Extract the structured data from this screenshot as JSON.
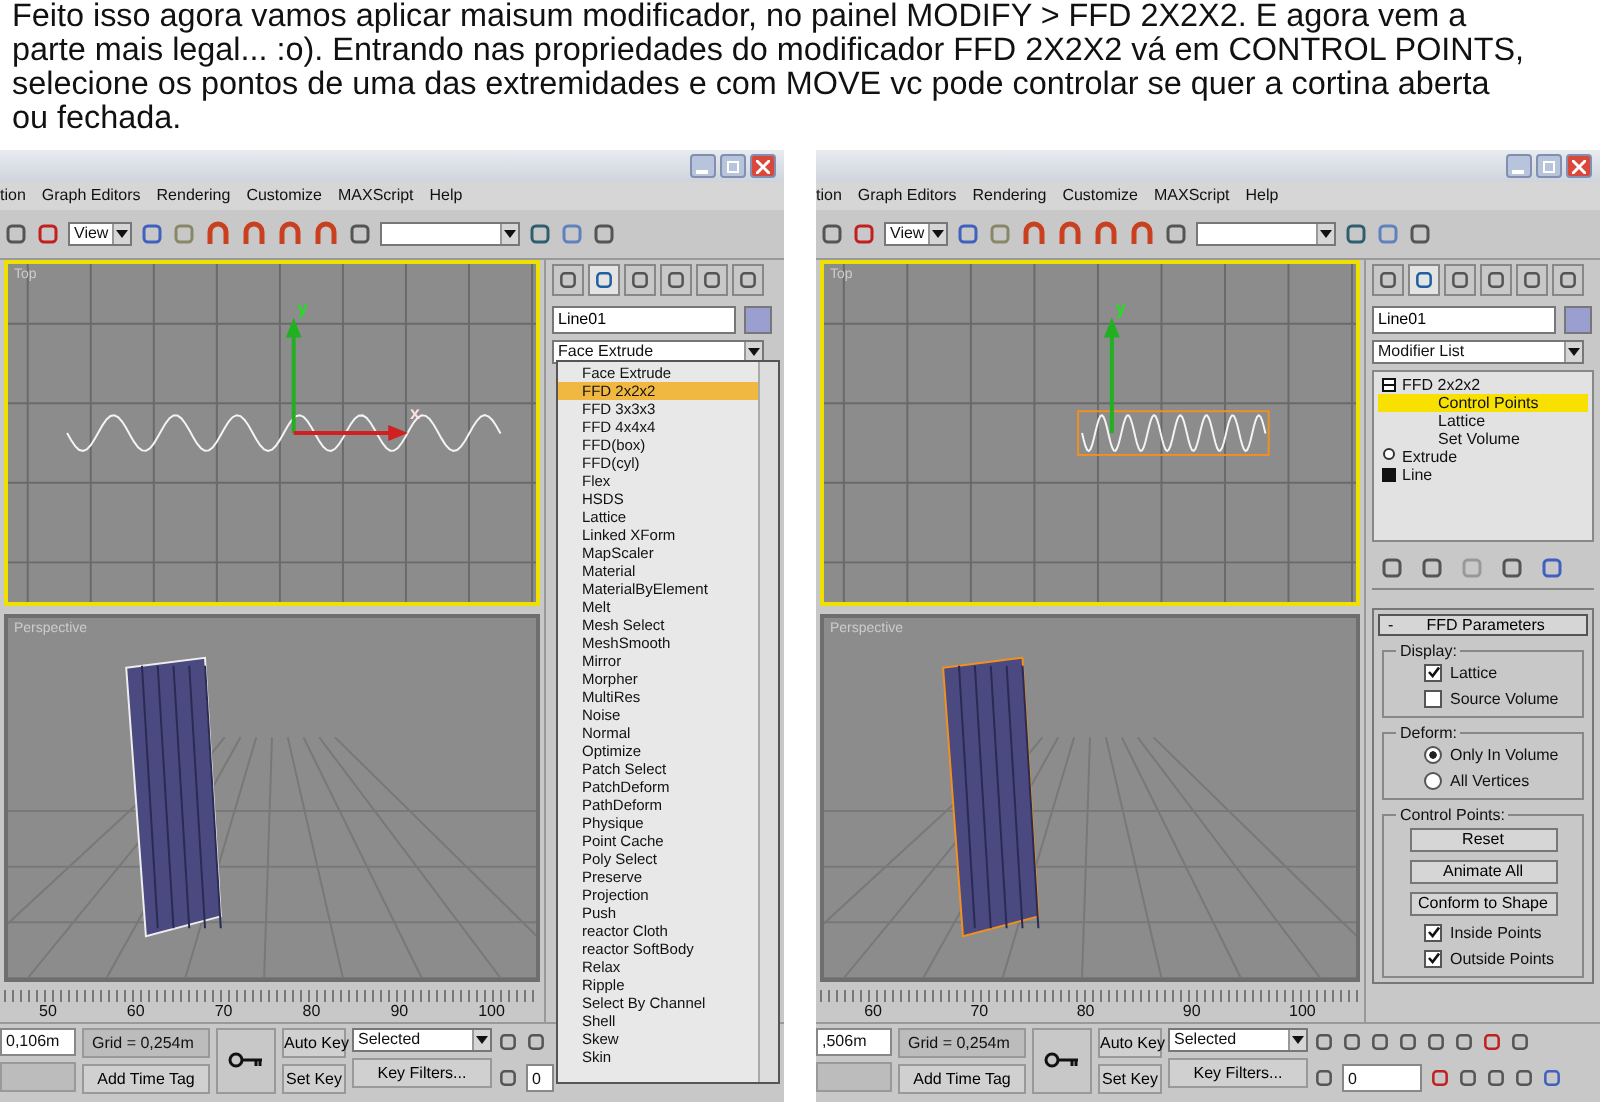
{
  "caption": "Feito isso agora vamos aplicar maisum modificador, no painel MODIFY > FFD 2X2X2. E agora vem a parte mais legal... :o).  Entrando nas propriedades do modificador FFD 2X2X2 vá em CONTROL POINTS, selecione os pontos de uma das extremidades e com MOVE vc pode controlar se quer a cortina aberta ou fechada.",
  "screens": [
    {
      "menu": [
        "tion",
        "Graph Editors",
        "Rendering",
        "Customize",
        "MAXScript",
        "Help"
      ],
      "view_dropdown": "View",
      "viewports": [
        {
          "label": "Top",
          "active": true,
          "kind": "wave",
          "gizmo_labels": [
            "y",
            "x"
          ]
        },
        {
          "label": "Perspective",
          "active": false,
          "kind": "curtain"
        }
      ],
      "object_name": "Line01",
      "modifier_dropdown": "Face Extrude",
      "modifier_list": [
        {
          "label": "Face Extrude",
          "selected": false
        },
        {
          "label": "FFD 2x2x2",
          "selected": true
        },
        {
          "label": "FFD 3x3x3",
          "selected": false
        },
        {
          "label": "FFD 4x4x4",
          "selected": false
        },
        {
          "label": "FFD(box)",
          "selected": false
        },
        {
          "label": "FFD(cyl)",
          "selected": false
        },
        {
          "label": "Flex",
          "selected": false
        },
        {
          "label": "HSDS",
          "selected": false
        },
        {
          "label": "Lattice",
          "selected": false
        },
        {
          "label": "Linked XForm",
          "selected": false
        },
        {
          "label": "MapScaler",
          "selected": false
        },
        {
          "label": "Material",
          "selected": false
        },
        {
          "label": "MaterialByElement",
          "selected": false
        },
        {
          "label": "Melt",
          "selected": false
        },
        {
          "label": "Mesh Select",
          "selected": false
        },
        {
          "label": "MeshSmooth",
          "selected": false
        },
        {
          "label": "Mirror",
          "selected": false
        },
        {
          "label": "Morpher",
          "selected": false
        },
        {
          "label": "MultiRes",
          "selected": false
        },
        {
          "label": "Noise",
          "selected": false
        },
        {
          "label": "Normal",
          "selected": false
        },
        {
          "label": "Optimize",
          "selected": false
        },
        {
          "label": "Patch Select",
          "selected": false
        },
        {
          "label": "PatchDeform",
          "selected": false
        },
        {
          "label": "PathDeform",
          "selected": false
        },
        {
          "label": "Physique",
          "selected": false
        },
        {
          "label": "Point Cache",
          "selected": false
        },
        {
          "label": "Poly Select",
          "selected": false
        },
        {
          "label": "Preserve",
          "selected": false
        },
        {
          "label": "Projection",
          "selected": false
        },
        {
          "label": "Push",
          "selected": false
        },
        {
          "label": "reactor Cloth",
          "selected": false
        },
        {
          "label": "reactor SoftBody",
          "selected": false
        },
        {
          "label": "Relax",
          "selected": false
        },
        {
          "label": "Ripple",
          "selected": false
        },
        {
          "label": "Select By Channel",
          "selected": false
        },
        {
          "label": "Shell",
          "selected": false
        },
        {
          "label": "Skew",
          "selected": false
        },
        {
          "label": "Skin",
          "selected": false
        }
      ],
      "ruler": [
        "50",
        "60",
        "70",
        "80",
        "90",
        "100"
      ],
      "coord": "0,106m",
      "grid": "Grid = 0,254m",
      "time_tag": "Add Time Tag",
      "auto_key": "Auto Key",
      "set_key": "Set Key",
      "key_mode": "Selected",
      "key_filters": "Key Filters...",
      "frame": "0"
    },
    {
      "menu": [
        "tion",
        "Graph Editors",
        "Rendering",
        "Customize",
        "MAXScript",
        "Help"
      ],
      "view_dropdown": "View",
      "viewports": [
        {
          "label": "Top",
          "active": true,
          "kind": "wave-lattice",
          "gizmo_labels": [
            "y"
          ]
        },
        {
          "label": "Perspective",
          "active": false,
          "kind": "curtain-lattice"
        }
      ],
      "object_name": "Line01",
      "modifier_dropdown": "Modifier List",
      "modifier_stack": [
        {
          "label": "FFD 2x2x2",
          "selected": false,
          "expanded": true,
          "children": [
            {
              "label": "Control Points",
              "selected": true
            },
            {
              "label": "Lattice",
              "selected": false
            },
            {
              "label": "Set Volume",
              "selected": false
            }
          ]
        },
        {
          "label": "Extrude",
          "selected": false
        },
        {
          "label": "Line",
          "selected": false,
          "expanded": false
        }
      ],
      "rollout": {
        "toggle": "-",
        "title": "FFD Parameters",
        "groups": [
          {
            "title": "Display:",
            "controls": [
              {
                "kind": "checkbox",
                "label": "Lattice",
                "checked": true
              },
              {
                "kind": "checkbox",
                "label": "Source Volume",
                "checked": false
              }
            ]
          },
          {
            "title": "Deform:",
            "controls": [
              {
                "kind": "radio",
                "label": "Only In Volume",
                "selected": true
              },
              {
                "kind": "radio",
                "label": "All Vertices",
                "selected": false
              }
            ]
          },
          {
            "title": "Control Points:",
            "controls": [
              {
                "kind": "button",
                "label": "Reset"
              },
              {
                "kind": "button",
                "label": "Animate All"
              },
              {
                "kind": "button",
                "label": "Conform to Shape"
              },
              {
                "kind": "checkbox",
                "label": "Inside Points",
                "checked": true
              },
              {
                "kind": "checkbox",
                "label": "Outside Points",
                "checked": true
              }
            ]
          }
        ]
      },
      "ruler": [
        "60",
        "70",
        "80",
        "90",
        "100"
      ],
      "coord": ",506m",
      "grid": "Grid = 0,254m",
      "time_tag": "Add Time Tag",
      "auto_key": "Auto Key",
      "set_key": "Set Key",
      "key_mode": "Selected",
      "key_filters": "Key Filters...",
      "frame": "0"
    }
  ]
}
